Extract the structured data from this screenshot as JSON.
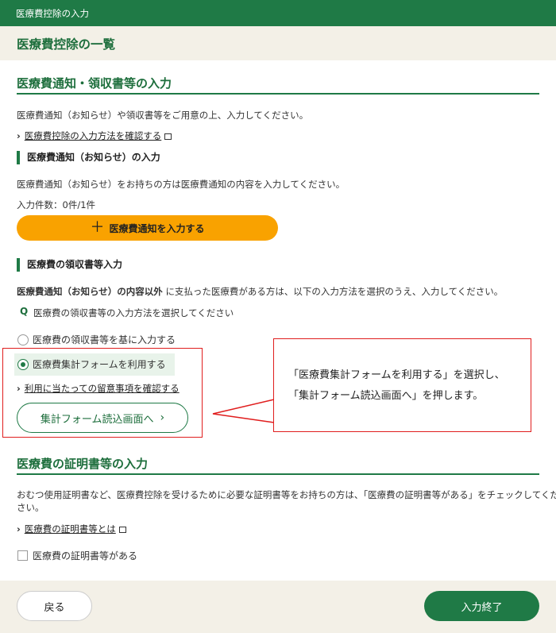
{
  "window": {
    "title": "医療費控除の入力"
  },
  "page": {
    "title": "医療費控除の一覧"
  },
  "notice_section": {
    "title": "医療費通知・領収書等の入力",
    "description": "医療費通知（お知らせ）や領収書等をご用意の上、入力してください。",
    "help_link": "医療費控除の入力方法を確認する"
  },
  "notice_input": {
    "title": "医療費通知（お知らせ）の入力",
    "description": "医療費通知（お知らせ）をお持ちの方は医療費通知の内容を入力してください。",
    "count": "入力件数：0件/1件",
    "button_label": "医療費通知を入力する",
    "button_icon": "plus-icon"
  },
  "receipt_input": {
    "title": "医療費の領収書等入力",
    "description_bold": "医療費通知（お知らせ）の内容以外",
    "description_rest": "に支払った医療費がある方は、以下の入力方法を選択のうえ、入力してください。",
    "question_mark": "Q",
    "question": "医療費の領収書等の入力方法を選択してください",
    "options": [
      {
        "label": "医療費の領収書等を基に入力する",
        "selected": false
      },
      {
        "label": "医療費集計フォームを利用する",
        "selected": true
      }
    ],
    "notes_link": "利用に当たっての留意事項を確認する",
    "form_button": "集計フォーム読込画面へ",
    "form_button_arrow": "›"
  },
  "callout": {
    "line1": "「医療費集計フォームを利用する」を選択し、",
    "line2": "「集計フォーム読込画面へ」を押します。",
    "border_color": "#e01e1e"
  },
  "certificate_section": {
    "title": "医療費の証明書等の入力",
    "description_line1": "おむつ使用証明書など、医療費控除を受けるために必要な証明書等をお持ちの方は、「医療費の証明書等がある」をチェックしてくだ",
    "description_line2": "さい。",
    "link": "医療費の証明書等とは",
    "checkbox_label": "医療費の証明書等がある",
    "checked": false
  },
  "footer": {
    "back_label": "戻る",
    "done_label": "入力終了"
  },
  "colors": {
    "brand_green": "#1f7a46",
    "accent_orange": "#f9a200",
    "header_bg": "#f3f0e7"
  }
}
